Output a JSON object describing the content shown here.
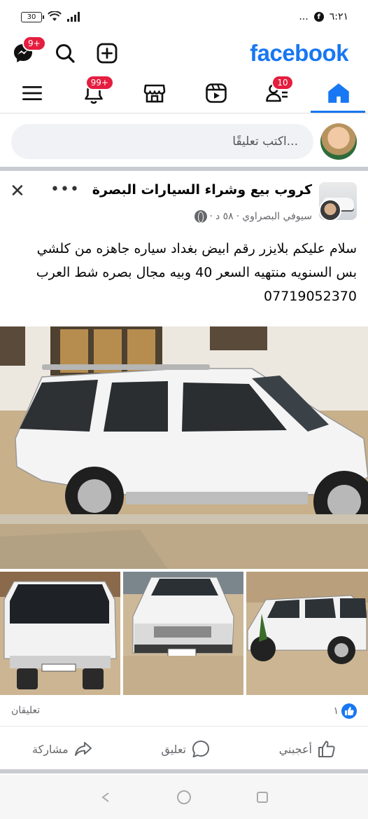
{
  "status_bar": {
    "time": "٦:٢١",
    "battery": "30",
    "dots": "..."
  },
  "header": {
    "logo": "facebook",
    "messenger_badge": "9+",
    "notifications_badge": "99+",
    "friends_badge": "10"
  },
  "composer": {
    "placeholder": "اكتب تعليقًا..."
  },
  "post": {
    "group_name": "كروب بيع وشراء السيارات البصرة",
    "author": "سيوفي البصراوي",
    "time": "٥٨ د",
    "separator": "·",
    "text_lines": [
      "سلام عليكم بلايزر رقم ابيض بغداد سياره جاهزه من كلشي",
      "بس السنويه منتهيه السعر 40 وبيه مجال بصره شط العرب",
      "07719052370"
    ],
    "likes_count": "١",
    "comments_label": "تعليقان"
  },
  "actions": {
    "like": "أعجبني",
    "comment": "تعليق",
    "share": "مشاركة"
  },
  "colors": {
    "brand": "#1877f2",
    "badge": "#e41e3f"
  }
}
